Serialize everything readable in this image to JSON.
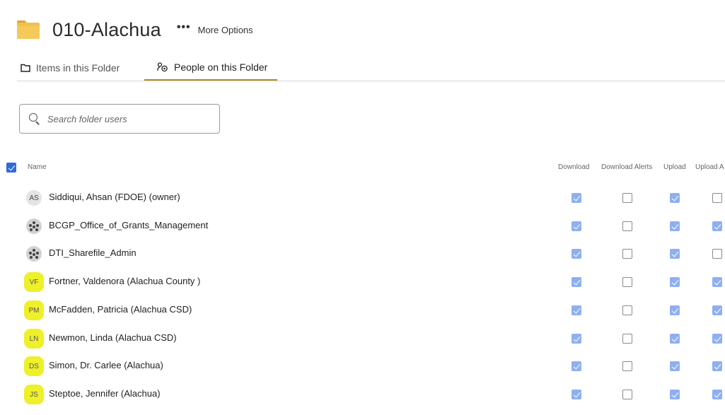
{
  "folder": {
    "title": "010-Alachua",
    "more_options_icon": "ellipsis-icon",
    "more_options_label": "More Options"
  },
  "tabs": [
    {
      "label": "Items in this Folder",
      "icon": "folder-outline-icon",
      "active": false
    },
    {
      "label": "People on this Folder",
      "icon": "people-settings-icon",
      "active": true
    }
  ],
  "search": {
    "placeholder": "Search folder users",
    "value": ""
  },
  "table": {
    "select_all_checked": true,
    "columns": {
      "name": "Name",
      "download": "Download",
      "download_alerts": "Download Alerts",
      "upload": "Upload",
      "upload_alerts": "Upload A"
    },
    "rows": [
      {
        "initials": "AS",
        "type": "user",
        "highlight": false,
        "name": "Siddiqui, Ahsan (FDOE) (owner)",
        "download": true,
        "download_alerts": false,
        "upload": true,
        "upload_alerts": false
      },
      {
        "initials": "",
        "type": "group",
        "highlight": false,
        "name": "BCGP_Office_of_Grants_Management",
        "download": true,
        "download_alerts": false,
        "upload": true,
        "upload_alerts": true
      },
      {
        "initials": "",
        "type": "group",
        "highlight": false,
        "name": "DTI_Sharefile_Admin",
        "download": true,
        "download_alerts": false,
        "upload": true,
        "upload_alerts": false
      },
      {
        "initials": "VF",
        "type": "user",
        "highlight": true,
        "name": "Fortner, Valdenora (Alachua County )",
        "download": true,
        "download_alerts": false,
        "upload": true,
        "upload_alerts": true
      },
      {
        "initials": "PM",
        "type": "user",
        "highlight": true,
        "name": "McFadden, Patricia (Alachua CSD)",
        "download": true,
        "download_alerts": false,
        "upload": true,
        "upload_alerts": true
      },
      {
        "initials": "LN",
        "type": "user",
        "highlight": true,
        "name": "Newmon, Linda (Alachua CSD)",
        "download": true,
        "download_alerts": false,
        "upload": true,
        "upload_alerts": true
      },
      {
        "initials": "DS",
        "type": "user",
        "highlight": true,
        "name": "Simon, Dr. Carlee (Alachua)",
        "download": true,
        "download_alerts": false,
        "upload": true,
        "upload_alerts": true
      },
      {
        "initials": "JS",
        "type": "user",
        "highlight": true,
        "name": "Steptoe, Jennifer (Alachua)",
        "download": true,
        "download_alerts": false,
        "upload": true,
        "upload_alerts": true
      }
    ]
  },
  "colors": {
    "checked_box": "#8fb0f0",
    "header_checkbox": "#2f6bd8",
    "active_tab_underline": "#b08d26",
    "avatar_highlight": "#eef02a",
    "folder_icon": "#f2c051"
  }
}
